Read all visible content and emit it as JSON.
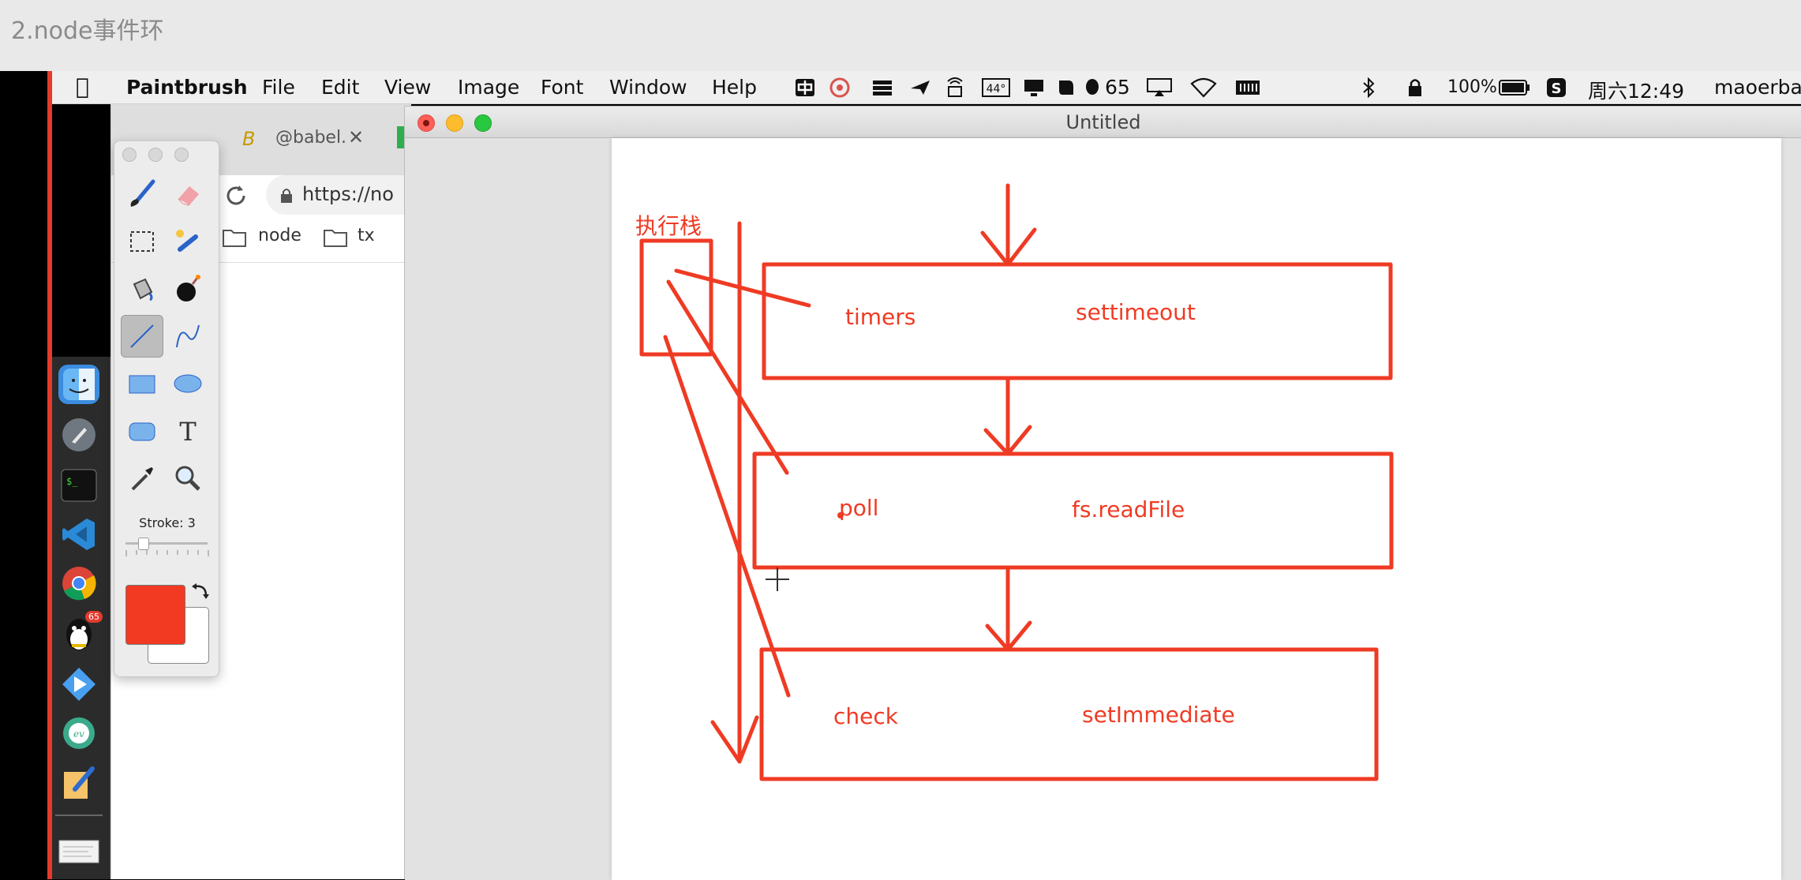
{
  "caption": "2.node事件环",
  "menubar": {
    "app_name": "Paintbrush",
    "menus": [
      "File",
      "Edit",
      "View",
      "Image",
      "Font",
      "Window",
      "Help"
    ],
    "qq_count": "65",
    "battery": "100%",
    "clock": "周六12:49",
    "user": "maoerbaby",
    "icons": [
      "apple-icon",
      "input-method-icon",
      "pinwheel-icon",
      "stack-icon",
      "plane-icon",
      "signal-icon",
      "cpu-temp-icon",
      "display-icon",
      "evernote-icon",
      "qq-icon",
      "airplay-icon",
      "wifi-icon",
      "memory-icon",
      "bluetooth-icon",
      "lock-icon",
      "battery-icon",
      "sogou-icon"
    ]
  },
  "browser": {
    "tab_label": "@babel.",
    "url": "https://no",
    "bookmarks": [
      "node",
      "tx"
    ]
  },
  "toolbox": {
    "stroke_label": "Stroke: 3",
    "fg_color": "#f23a22",
    "bg_color": "#ffffff",
    "tools": [
      "brush-tool",
      "eraser-tool",
      "select-rect-tool",
      "magic-wand-tool",
      "bucket-tool",
      "bomb-tool",
      "line-tool",
      "curve-tool",
      "rectangle-tool",
      "ellipse-tool",
      "rounded-rect-tool",
      "text-tool",
      "eyedropper-tool",
      "zoom-tool"
    ]
  },
  "window": {
    "title": "Untitled"
  },
  "drawing": {
    "stack_label": "执行栈",
    "phases": [
      {
        "name": "timers",
        "api": "settimeout"
      },
      {
        "name": "poll",
        "api": "fs.readFile"
      },
      {
        "name": "check",
        "api": "setImmediate"
      }
    ],
    "stroke_color": "#ef3b24"
  },
  "dock": {
    "apps": [
      "finder-icon",
      "launchpad-icon",
      "terminal-icon",
      "vscode-icon",
      "chrome-icon",
      "qq-icon",
      "thunder-icon",
      "eve-icon",
      "paintbrush-icon",
      "document-icon"
    ],
    "qq_badge": "65"
  }
}
